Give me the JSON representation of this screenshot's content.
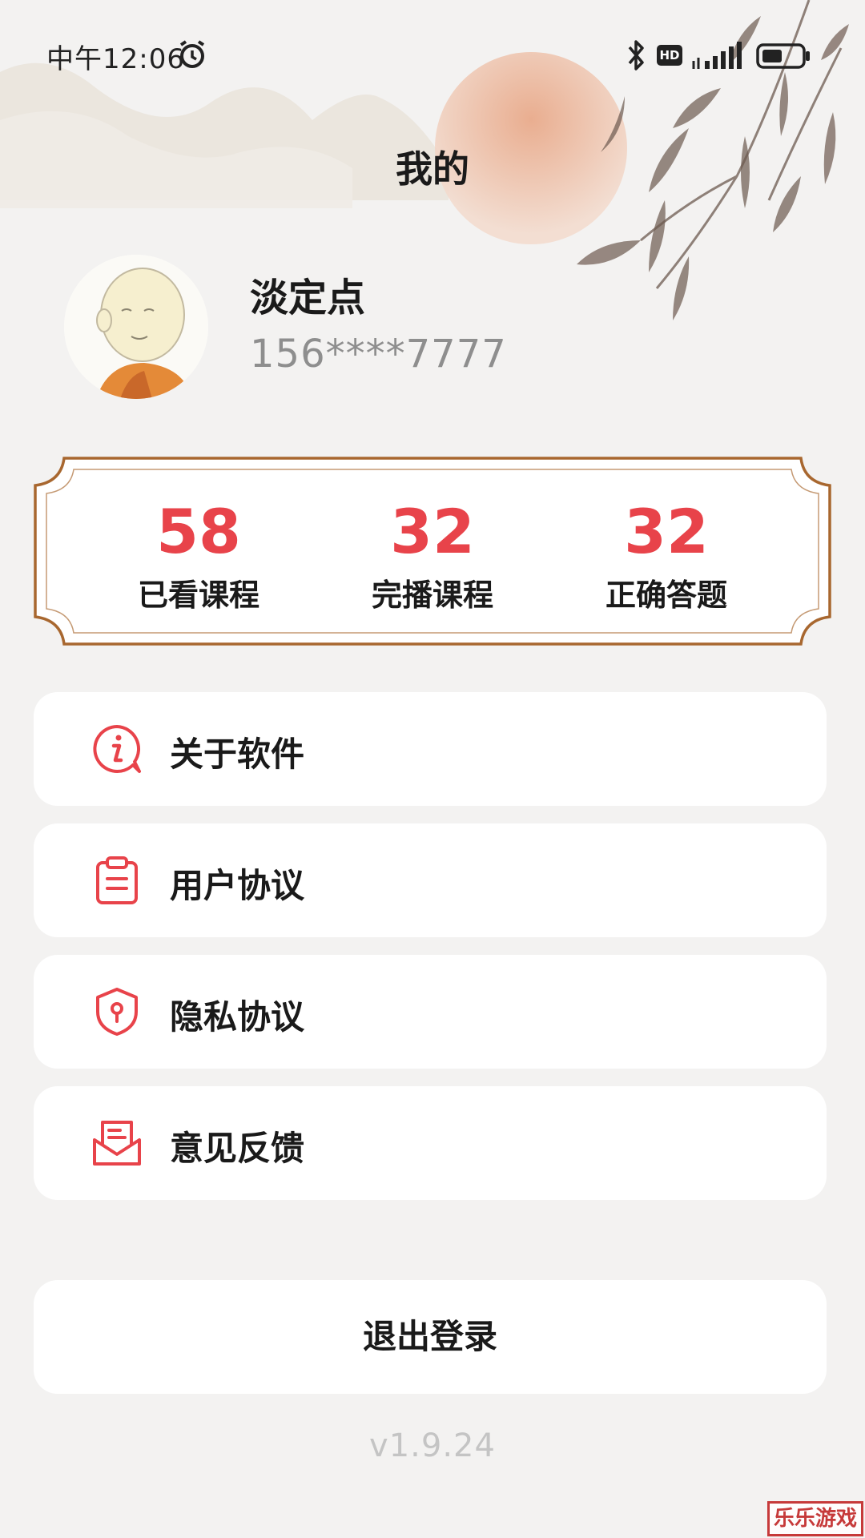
{
  "status_bar": {
    "time": "中午12:06",
    "network_badge": "HD"
  },
  "header": {
    "title": "我的"
  },
  "profile": {
    "name": "淡定点",
    "phone": "156****7777"
  },
  "stats": [
    {
      "value": "58",
      "label": "已看课程"
    },
    {
      "value": "32",
      "label": "完播课程"
    },
    {
      "value": "32",
      "label": "正确答题"
    }
  ],
  "menu": [
    {
      "label": "关于软件",
      "icon": "info-icon"
    },
    {
      "label": "用户协议",
      "icon": "clipboard-icon"
    },
    {
      "label": "隐私协议",
      "icon": "shield-icon"
    },
    {
      "label": "意见反馈",
      "icon": "feedback-mail-icon"
    }
  ],
  "logout_label": "退出登录",
  "version": "v1.9.24",
  "watermark": "乐乐游戏",
  "colors": {
    "accent": "#e8434a",
    "frame": "#a8672f",
    "background": "#f3f2f1"
  }
}
